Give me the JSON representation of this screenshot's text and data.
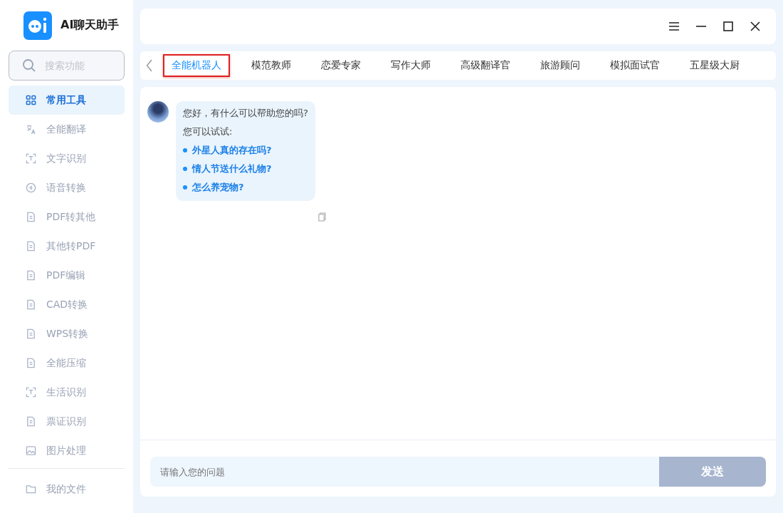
{
  "app": {
    "title": "AI聊天助手"
  },
  "search": {
    "placeholder": "搜索功能"
  },
  "sidebar": {
    "items": [
      {
        "label": "常用工具",
        "selected": true
      },
      {
        "label": "全能翻译",
        "selected": false
      },
      {
        "label": "文字识别",
        "selected": false
      },
      {
        "label": "语音转换",
        "selected": false
      },
      {
        "label": "PDF转其他",
        "selected": false
      },
      {
        "label": "其他转PDF",
        "selected": false
      },
      {
        "label": "PDF编辑",
        "selected": false
      },
      {
        "label": "CAD转换",
        "selected": false
      },
      {
        "label": "WPS转换",
        "selected": false
      },
      {
        "label": "全能压缩",
        "selected": false
      },
      {
        "label": "生活识别",
        "selected": false
      },
      {
        "label": "票证识别",
        "selected": false
      },
      {
        "label": "图片处理",
        "selected": false
      }
    ],
    "footer": {
      "label": "我的文件",
      "selected": false
    }
  },
  "tabs": [
    {
      "label": "全能机器人",
      "selected": true
    },
    {
      "label": "模范教师",
      "selected": false
    },
    {
      "label": "恋爱专家",
      "selected": false
    },
    {
      "label": "写作大师",
      "selected": false
    },
    {
      "label": "高级翻译官",
      "selected": false
    },
    {
      "label": "旅游顾问",
      "selected": false
    },
    {
      "label": "模拟面试官",
      "selected": false
    },
    {
      "label": "五星级大厨",
      "selected": false
    }
  ],
  "message": {
    "greeting": "您好，有什么可以帮助您的吗?",
    "prompt": "您可以试试:",
    "suggestions": [
      "外星人真的存在吗?",
      "情人节送什么礼物?",
      "怎么养宠物?"
    ]
  },
  "input": {
    "placeholder": "请输入您的问题"
  },
  "send_button": {
    "label": "发送",
    "disabled": true
  }
}
